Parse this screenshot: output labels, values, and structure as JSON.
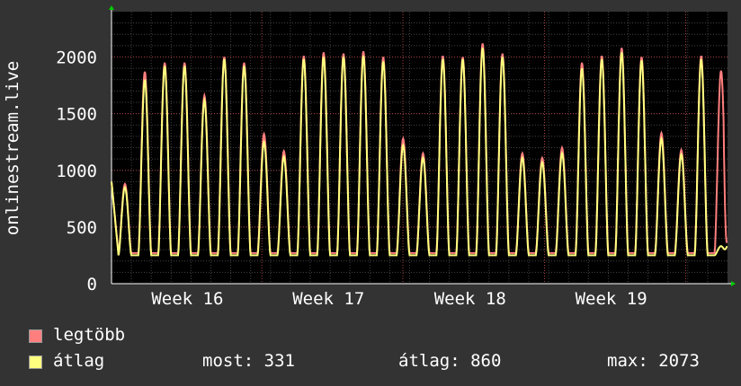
{
  "chart_data": {
    "type": "line",
    "title": "",
    "xlabel": "",
    "ylabel": "onlinestream.live",
    "ylim": [
      0,
      2400
    ],
    "yticks": [
      0,
      500,
      1000,
      1500,
      2000
    ],
    "xtick_labels": [
      "Week 16",
      "Week 17",
      "Week 18",
      "Week 19"
    ],
    "grid": true,
    "legend_placement": "bottom-left",
    "series": [
      {
        "name": "legtöbb",
        "color": "#ff7f7f",
        "daily_peaks": [
          880,
          1870,
          1950,
          1950,
          1660,
          2000,
          1950,
          1320,
          1170,
          2010,
          2040,
          2030,
          2050,
          2000,
          1280,
          1150,
          2010,
          2000,
          2120,
          2030,
          1150,
          1110,
          1200,
          1950,
          2010,
          2080,
          2000,
          1330,
          1180,
          2010,
          1880
        ]
      },
      {
        "name": "átlag",
        "color": "#ffff7f",
        "daily_peaks": [
          850,
          1800,
          1920,
          1920,
          1620,
          1980,
          1920,
          1250,
          1120,
          1980,
          2000,
          2000,
          2010,
          1960,
          1220,
          1110,
          1980,
          1980,
          2080,
          2000,
          1110,
          1070,
          1150,
          1900,
          1980,
          2040,
          1970,
          1280,
          1140,
          1980,
          331
        ]
      }
    ]
  },
  "legend": {
    "items": [
      {
        "label": "legtöbb",
        "color": "#ff7f7f"
      },
      {
        "label": "átlag",
        "color": "#ffff7f"
      }
    ],
    "stats": {
      "now": "most: 331",
      "avg": "átlag: 860",
      "max": "max: 2073"
    }
  }
}
